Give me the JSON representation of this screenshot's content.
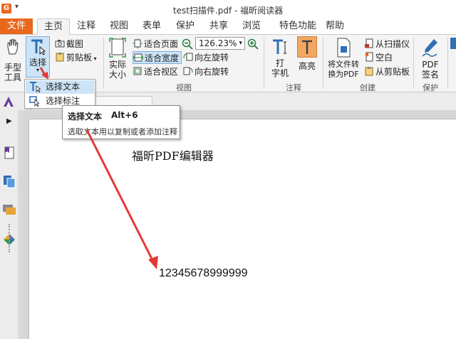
{
  "window": {
    "title": "test扫描件.pdf - 福昕阅读器"
  },
  "menu": {
    "file": "文件",
    "tabs": [
      "主页",
      "注释",
      "视图",
      "表单",
      "保护",
      "共享",
      "浏览",
      "特色功能",
      "帮助"
    ]
  },
  "ribbon": {
    "hand_tool": "手型\n工具",
    "select": "选择",
    "screenshot": "截图",
    "clipboard": "剪贴板",
    "actual_size": "实际\n大小",
    "fit_page": "适合页面",
    "fit_width": "适合宽度",
    "fit_visible": "适合视区",
    "zoom_value": "126.23%",
    "rotate_left": "向左旋转",
    "rotate_right": "向右旋转",
    "view_group": "视图",
    "typewriter": "打\n字机",
    "highlight": "高亮",
    "comment_group": "注释",
    "convert_pdf": "将文件转\n换为PDF",
    "from_scanner": "从扫描仪",
    "blank": "空白",
    "from_clipboard": "从剪贴板",
    "create_group": "创建",
    "pdf_sign": "PDF\n签名",
    "protect_group": "保护"
  },
  "dropdown": {
    "items": [
      "选择文本",
      "选择标注"
    ]
  },
  "tooltip": {
    "title": "选择文本",
    "shortcut": "Alt+6",
    "description": "选取文本用以复制或者添加注释"
  },
  "document": {
    "heading": "福昕PDF编辑器",
    "number_text": "12345678999999"
  },
  "colors": {
    "brand_orange": "#e8681e",
    "selection_blue": "#cde4f7",
    "annotation_arrow": "#e53935"
  }
}
